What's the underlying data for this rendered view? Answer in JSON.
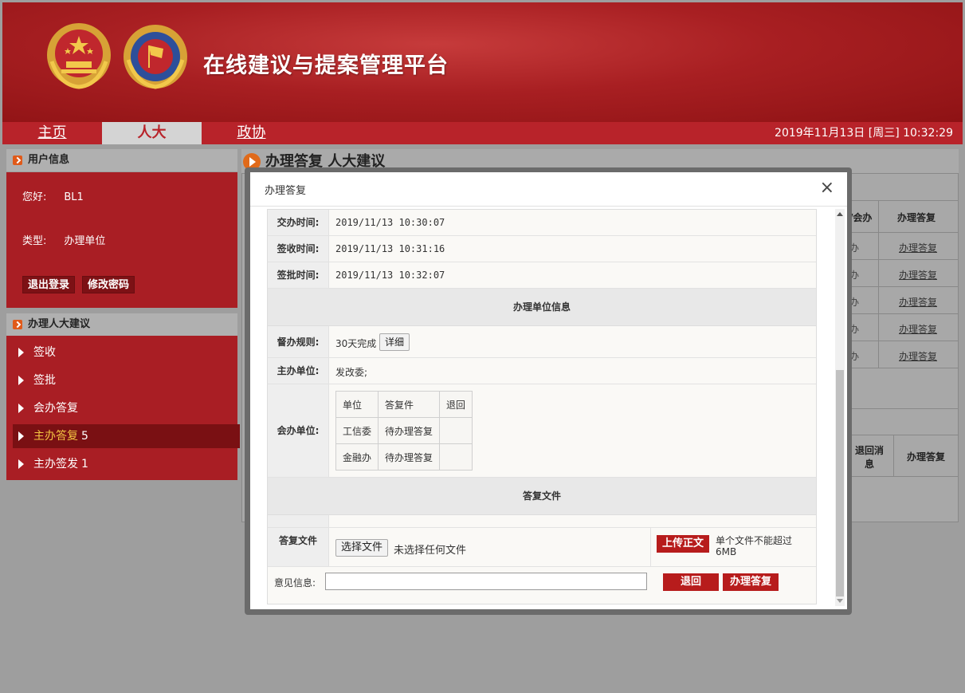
{
  "header": {
    "title": "在线建议与提案管理平台"
  },
  "nav": {
    "tabs": [
      "主页",
      "人大",
      "政协"
    ],
    "datetime": "2019年11月13日 [周三] 10:32:29"
  },
  "user_panel": {
    "heading": "用户信息",
    "greeting_label": "您好:",
    "username": "BL1",
    "type_label": "类型:",
    "type_value": "办理单位",
    "logout_label": "退出登录",
    "change_password_label": "修改密码"
  },
  "menu_panel": {
    "heading": "办理人大建议",
    "items": [
      {
        "label": "签收",
        "count": ""
      },
      {
        "label": "签批",
        "count": ""
      },
      {
        "label": "会办答复",
        "count": ""
      },
      {
        "label": "主办答复",
        "count": "5"
      },
      {
        "label": "主办签发",
        "count": "1"
      }
    ]
  },
  "content": {
    "title": "办理答复  人大建议",
    "table_headers": [
      "/会办",
      "办理答复"
    ],
    "rows": [
      {
        "cell": "办",
        "link": "办理答复"
      },
      {
        "cell": "办",
        "link": "办理答复"
      },
      {
        "cell": "办",
        "link": "办理答复"
      },
      {
        "cell": "办",
        "link": "办理答复"
      },
      {
        "cell": "办",
        "link": "办理答复"
      }
    ],
    "table2_headers": [
      "退回消息",
      "办理答复"
    ]
  },
  "modal": {
    "title": "办理答复",
    "close_icon": "×",
    "fields": [
      {
        "label": "交办时间:",
        "value": "2019/11/13 10:30:07"
      },
      {
        "label": "签收时间:",
        "value": "2019/11/13 10:31:16"
      },
      {
        "label": "签批时间:",
        "value": "2019/11/13 10:32:07"
      }
    ],
    "section_unit_info": "办理单位信息",
    "supervise_label": "督办规则:",
    "supervise_value": "30天完成",
    "detail_button": "详细",
    "host_unit_label": "主办单位:",
    "host_unit_value": "发改委;",
    "co_unit_label": "会办单位:",
    "co_table": {
      "headers": [
        "单位",
        "答复件",
        "退回"
      ],
      "rows": [
        [
          "工信委",
          "待办理答复",
          ""
        ],
        [
          "金融办",
          "待办理答复",
          ""
        ]
      ]
    },
    "section_reply_files": "答复文件",
    "reply_file_label": "答复文件",
    "choose_file_button": "选择文件",
    "no_file_text": "未选择任何文件",
    "upload_button": "上传正文",
    "upload_hint": "单个文件不能超过6MB",
    "opinion_label": "意见信息:",
    "opinion_value": "",
    "return_button": "退回",
    "reply_button": "办理答复"
  }
}
